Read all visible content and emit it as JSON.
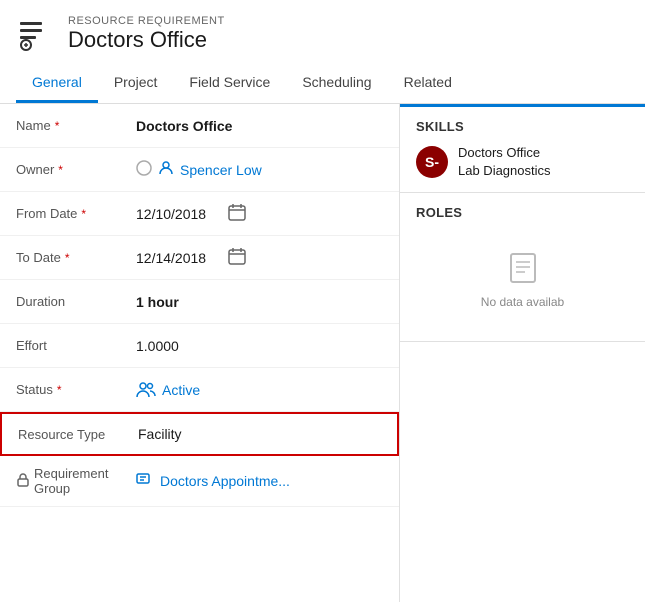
{
  "header": {
    "subtitle": "RESOURCE REQUIREMENT",
    "title": "Doctors Office"
  },
  "nav": {
    "tabs": [
      {
        "label": "General",
        "active": true
      },
      {
        "label": "Project",
        "active": false
      },
      {
        "label": "Field Service",
        "active": false
      },
      {
        "label": "Scheduling",
        "active": false
      },
      {
        "label": "Related",
        "active": false
      }
    ]
  },
  "form": {
    "fields": [
      {
        "label": "Name",
        "required": true,
        "value": "Doctors Office",
        "type": "bold"
      },
      {
        "label": "Owner",
        "required": true,
        "value": "Spencer Low",
        "type": "owner"
      },
      {
        "label": "From Date",
        "required": true,
        "value": "12/10/2018",
        "type": "date"
      },
      {
        "label": "To Date",
        "required": true,
        "value": "12/14/2018",
        "type": "date"
      },
      {
        "label": "Duration",
        "required": false,
        "value": "1 hour",
        "type": "bold"
      },
      {
        "label": "Effort",
        "required": false,
        "value": "1.0000",
        "type": "normal"
      },
      {
        "label": "Status",
        "required": true,
        "value": "Active",
        "type": "status"
      },
      {
        "label": "Resource Type",
        "required": false,
        "value": "Facility",
        "type": "highlighted"
      }
    ],
    "requirement_group": {
      "label": "Requirement Group",
      "value": "Doctors Appointme..."
    }
  },
  "right_panel": {
    "skills_title": "Skills",
    "skill_avatar_text": "S-",
    "skill_name": "Doctors Office Lab Diagnostics",
    "roles_title": "Roles",
    "no_data_text": "No data availab"
  }
}
